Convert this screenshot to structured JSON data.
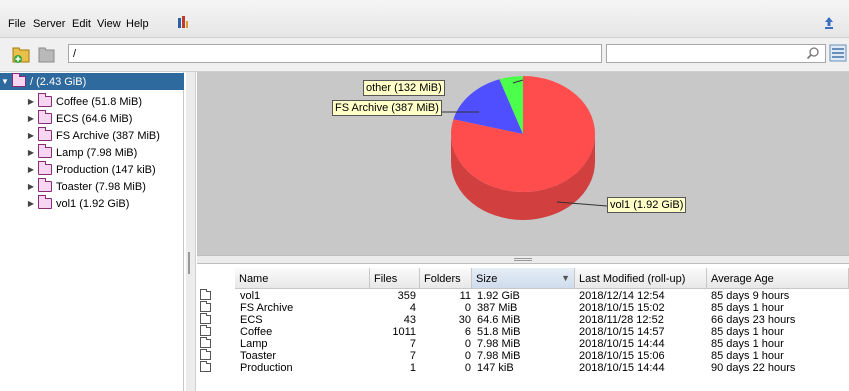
{
  "menu": [
    "File",
    "Server",
    "Edit",
    "View",
    "Help"
  ],
  "toolbar": {
    "path_value": "/",
    "search_value": ""
  },
  "icons": {
    "add_folder": "folder-add-icon",
    "remove": "remove-icon",
    "search": "search-icon",
    "view": "list-view-icon",
    "logo": "app-logo-icon",
    "update": "update-icon"
  },
  "tree": {
    "root": "/ (2.43 GiB)",
    "items": [
      "Coffee (51.8 MiB)",
      "ECS (64.6 MiB)",
      "FS Archive (387 MiB)",
      "Lamp (7.98 MiB)",
      "Production (147 kiB)",
      "Toaster (7.98 MiB)",
      "vol1 (1.92 GiB)"
    ]
  },
  "chart_data": {
    "type": "pie",
    "slices": [
      {
        "label": "vol1 (1.92 GiB)",
        "value": 1.92,
        "color": "#ff4d4d"
      },
      {
        "label": "FS Archive (387 MiB)",
        "value": 0.378,
        "color": "#4f4fff"
      },
      {
        "label": "other (132 MiB)",
        "value": 0.129,
        "color": "#4dff4d"
      }
    ]
  },
  "table": {
    "headers": [
      "Name",
      "Files",
      "Folders",
      "Size",
      "Last Modified (roll-up)",
      "Average Age"
    ],
    "rows": [
      [
        "vol1",
        "359",
        "11",
        "1.92 GiB",
        "2018/12/14 12:54",
        "85 days 9 hours"
      ],
      [
        "FS Archive",
        "4",
        "0",
        "387 MiB",
        "2018/10/15 15:02",
        "85 days 1 hour"
      ],
      [
        "ECS",
        "43",
        "30",
        "64.6 MiB",
        "2018/11/28 12:52",
        "66 days 23 hours"
      ],
      [
        "Coffee",
        "1011",
        "6",
        "51.8 MiB",
        "2018/10/15 14:57",
        "85 days 1 hour"
      ],
      [
        "Lamp",
        "7",
        "0",
        "7.98 MiB",
        "2018/10/15 14:44",
        "85 days 1 hour"
      ],
      [
        "Toaster",
        "7",
        "0",
        "7.98 MiB",
        "2018/10/15 15:06",
        "85 days 1 hour"
      ],
      [
        "Production",
        "1",
        "0",
        "147 kiB",
        "2018/10/15 14:44",
        "90 days 22 hours"
      ]
    ]
  }
}
